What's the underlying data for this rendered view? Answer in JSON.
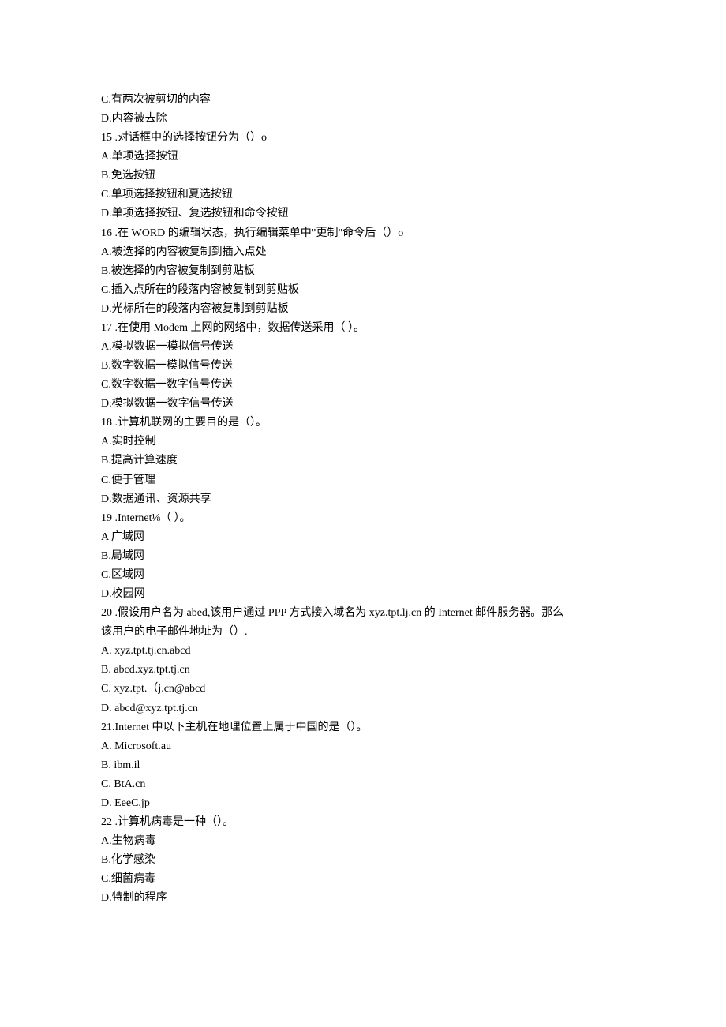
{
  "lines": [
    "C.有两次被剪切的内容",
    "D.内容被去除",
    "15   .对话框中的选择按钮分为（）o",
    "A.单项选择按钮",
    "B.免选按钮",
    "C.单项选择按钮和夏选按钮",
    "D.单项选择按钮、复选按钮和命令按钮",
    "16   .在 WORD 的编辑状态，执行编辑菜单中\"更制\"命令后（）o",
    "A.被选择的内容被复制到插入点处",
    "B.被选择的内容被复制到剪贴板",
    "C.插入点所在的段落内容被复制到剪贴板",
    "D.光标所在的段落内容被复制到剪贴板",
    "17   .在使用 Modem 上网的网络中，数据传送采用（     ）。",
    "A.模拟数据一模拟信号传送",
    "B.数字数据一模拟信号传送",
    "C.数字数据一数字信号传送",
    "D.模拟数据一数字信号传送",
    "18   .计算机联网的主要目的是（）。",
    "A.实时控制",
    "B.提高计算速度",
    "C.便于管理",
    "D.数据通讯、资源共享",
    "19   .Internet⅛（     ）。",
    "A 广域网",
    "B.局域网",
    "C.区域网",
    "D.校园网",
    "20   .假设用户名为 abed,该用户通过 PPP 方式接入域名为 xyz.tpt.lj.cn 的 Internet 邮件服务器。那么",
    "该用户的电子邮件地址为（）.",
    "A.    xyz.tpt.tj.cn.abcd",
    "B.    abcd.xyz.tpt.tj.cn",
    "C.    xyz.tpt.（j.cn@abcd",
    "D.    abcd@xyz.tpt.tj.cn",
    "21.Internet 中以下主机在地理位置上属于中国的是（）。",
    "A.    Microsoft.au",
    "B.    ibm.il",
    "C.    BtA.cn",
    "D.    EeeC.jp",
    "22   .计算机病毒是一种（）。",
    "A.生物病毒",
    "B.化学感染",
    "C.细菌病毒",
    "D.特制的程序"
  ]
}
